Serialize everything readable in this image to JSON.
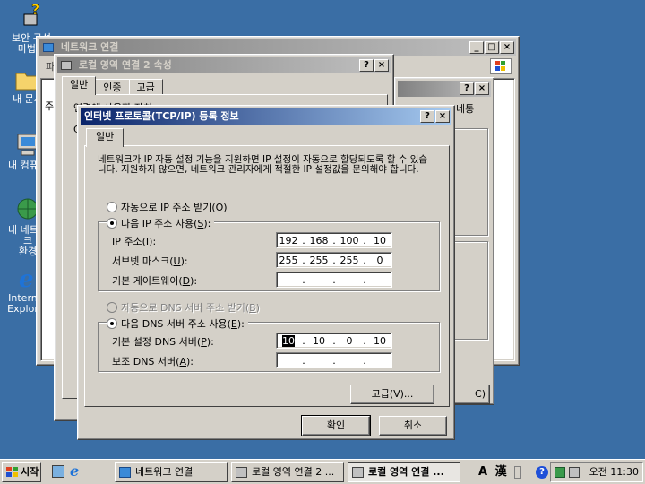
{
  "desktop": {
    "icons": [
      {
        "label_lines": [
          "보안 구성",
          "마법사"
        ]
      },
      {
        "label_lines": [
          "내 문서"
        ]
      },
      {
        "label_lines": [
          "내 컴퓨터"
        ]
      },
      {
        "label_lines": [
          "내 네트워크",
          "환경"
        ]
      },
      {
        "label_lines": [
          "Internet",
          "Explorer"
        ]
      }
    ]
  },
  "network_window": {
    "title": "네트워크 연결",
    "menu_partial": "파",
    "side_letters": [
      "주",
      "C",
      "N"
    ],
    "partial_text": "0"
  },
  "props_window": {
    "title": "로컬 영역 연결 2 속성",
    "tabs": [
      "일반",
      "인증",
      "고급"
    ],
    "connect_using_partial": "연결에 사용할 장치:",
    "side_letter": "C"
  },
  "status_window": {
    "col_partial": "네통",
    "close_button_partial": "C)"
  },
  "tcpip_dialog": {
    "title": "인터넷 프로토콜(TCP/IP) 등록 정보",
    "tab": "일반",
    "description": "네트워크가 IP 자동 설정 기능을 지원하면 IP 설정이 자동으로 할당되도록 할 수 있습니다. 지원하지 않으면, 네트워크 관리자에게 적절한 IP 설정값을 문의해야 합니다.",
    "auto_ip_label": "자동으로 IP 주소 받기(",
    "auto_ip_key": "O",
    "manual_ip_label": "다음 IP 주소 사용(",
    "manual_ip_key": "S",
    "ip_label": "IP 주소(",
    "ip_key": "I",
    "ip_address": [
      "192",
      "168",
      "100",
      "10"
    ],
    "subnet_label": "서브넷 마스크(",
    "subnet_key": "U",
    "subnet_mask": [
      "255",
      "255",
      "255",
      "0"
    ],
    "gateway_label": "기본 게이트웨이(",
    "gateway_key": "D",
    "gateway": [
      "",
      "",
      "",
      ""
    ],
    "auto_dns_label": "자동으로 DNS 서버 주소 받기(",
    "auto_dns_key": "B",
    "manual_dns_label": "다음 DNS 서버 주소 사용(",
    "manual_dns_key": "E",
    "preferred_dns_label": "기본 설정 DNS 서버(",
    "preferred_dns_key": "P",
    "preferred_dns": [
      "10",
      "10",
      "0",
      "10"
    ],
    "alternate_dns_label": "보조 DNS 서버(",
    "alternate_dns_key": "A",
    "alternate_dns": [
      "",
      "",
      "",
      ""
    ],
    "advanced_button": "고급(V)...",
    "ok_button": "확인",
    "cancel_button": "취소",
    "close_paren": ")",
    "colon": ":"
  },
  "taskbar": {
    "start": "시작",
    "tasks": [
      {
        "label": "네트워크 연결",
        "pressed": false
      },
      {
        "label": "로컬 영역 연결 2 ...",
        "pressed": false
      },
      {
        "label": "로컬 영역 연결 ...",
        "pressed": true
      }
    ],
    "ime": [
      "A",
      "漢"
    ],
    "clock": "오전 11:30"
  }
}
